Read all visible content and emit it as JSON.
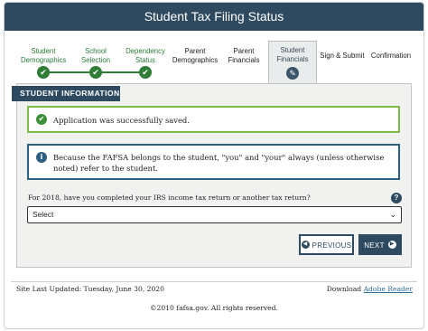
{
  "header": {
    "title": "Student Tax Filing Status"
  },
  "steps": [
    {
      "label_1": "Student",
      "label_2": "Demographics",
      "state": "done",
      "icon": "check-icon"
    },
    {
      "label_1": "School",
      "label_2": "Selection",
      "state": "done",
      "icon": "check-icon"
    },
    {
      "label_1": "Dependency",
      "label_2": "Status",
      "state": "done",
      "icon": "check-icon"
    },
    {
      "label_1": "Parent",
      "label_2": "Demographics",
      "state": "pending"
    },
    {
      "label_1": "Parent",
      "label_2": "Financials",
      "state": "pending"
    },
    {
      "label_1": "Student",
      "label_2": "Financials",
      "state": "active",
      "icon": "pencil-icon"
    },
    {
      "label_1": "Sign & Submit",
      "label_2": "",
      "state": "pending"
    },
    {
      "label_1": "Confirmation",
      "label_2": "",
      "state": "pending"
    }
  ],
  "section": {
    "title": "STUDENT INFORMATION"
  },
  "alerts": {
    "success": {
      "text": "Application was successfully saved.",
      "icon": "check-circle-icon"
    },
    "info": {
      "text": "Because the FAFSA belongs to the student, \"you\" and \"your\" always (unless otherwise noted) refer to the student.",
      "icon": "info-icon"
    }
  },
  "question": {
    "text": "For 2018, have you completed your IRS income tax return or another tax return?",
    "help_glyph": "?",
    "selected": "Select"
  },
  "buttons": {
    "previous": "PREVIOUS",
    "next": "NEXT"
  },
  "footer": {
    "updated": "Site Last Updated: Tuesday, June 30, 2020",
    "download_prefix": "Download",
    "download_link": "Adobe Reader",
    "copyright": "©2010 fafsa.gov. All rights reserved."
  },
  "colors": {
    "primary": "#2d4a61",
    "success": "#2f7d36",
    "success_border": "#7dbb4b",
    "link": "#2a6f9a"
  }
}
